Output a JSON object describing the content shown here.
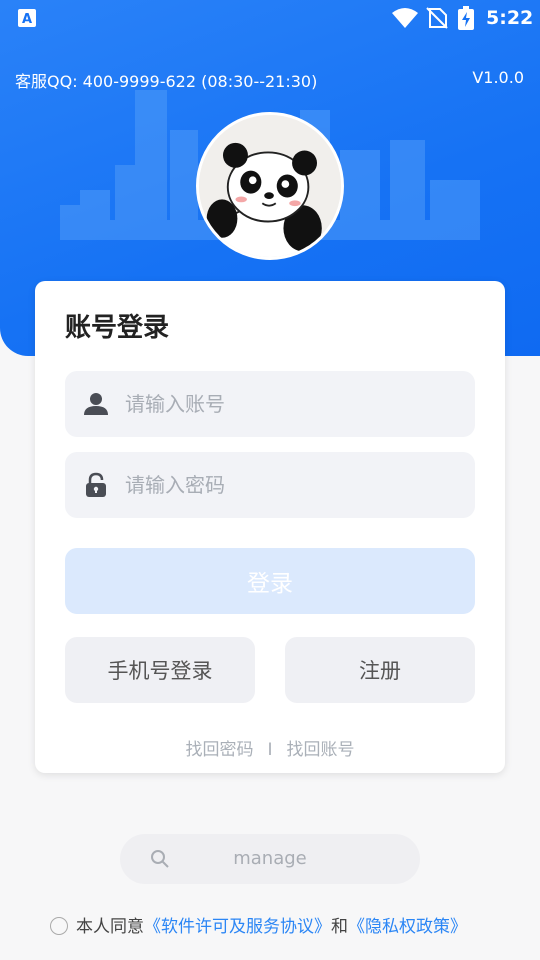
{
  "status_bar": {
    "time": "5:22"
  },
  "header": {
    "service": "客服QQ: 400-9999-622 (08:30--21:30)",
    "version": "V1.0.0"
  },
  "card": {
    "title": "账号登录",
    "account_placeholder": "请输入账号",
    "password_placeholder": "请输入密码",
    "login_label": "登录",
    "phone_login_label": "手机号登录",
    "register_label": "注册",
    "forgot_password": "找回密码",
    "separator": "I",
    "forgot_account": "找回账号"
  },
  "manage": {
    "label": "manage"
  },
  "agreement": {
    "prefix": "本人同意",
    "software_link": "《软件许可及服务协议》",
    "and": "和",
    "privacy_link": "《隐私权政策》"
  },
  "colors": {
    "primary": "#1672f4",
    "link": "#2b86f5",
    "login_disabled": "#dbe9fd"
  }
}
